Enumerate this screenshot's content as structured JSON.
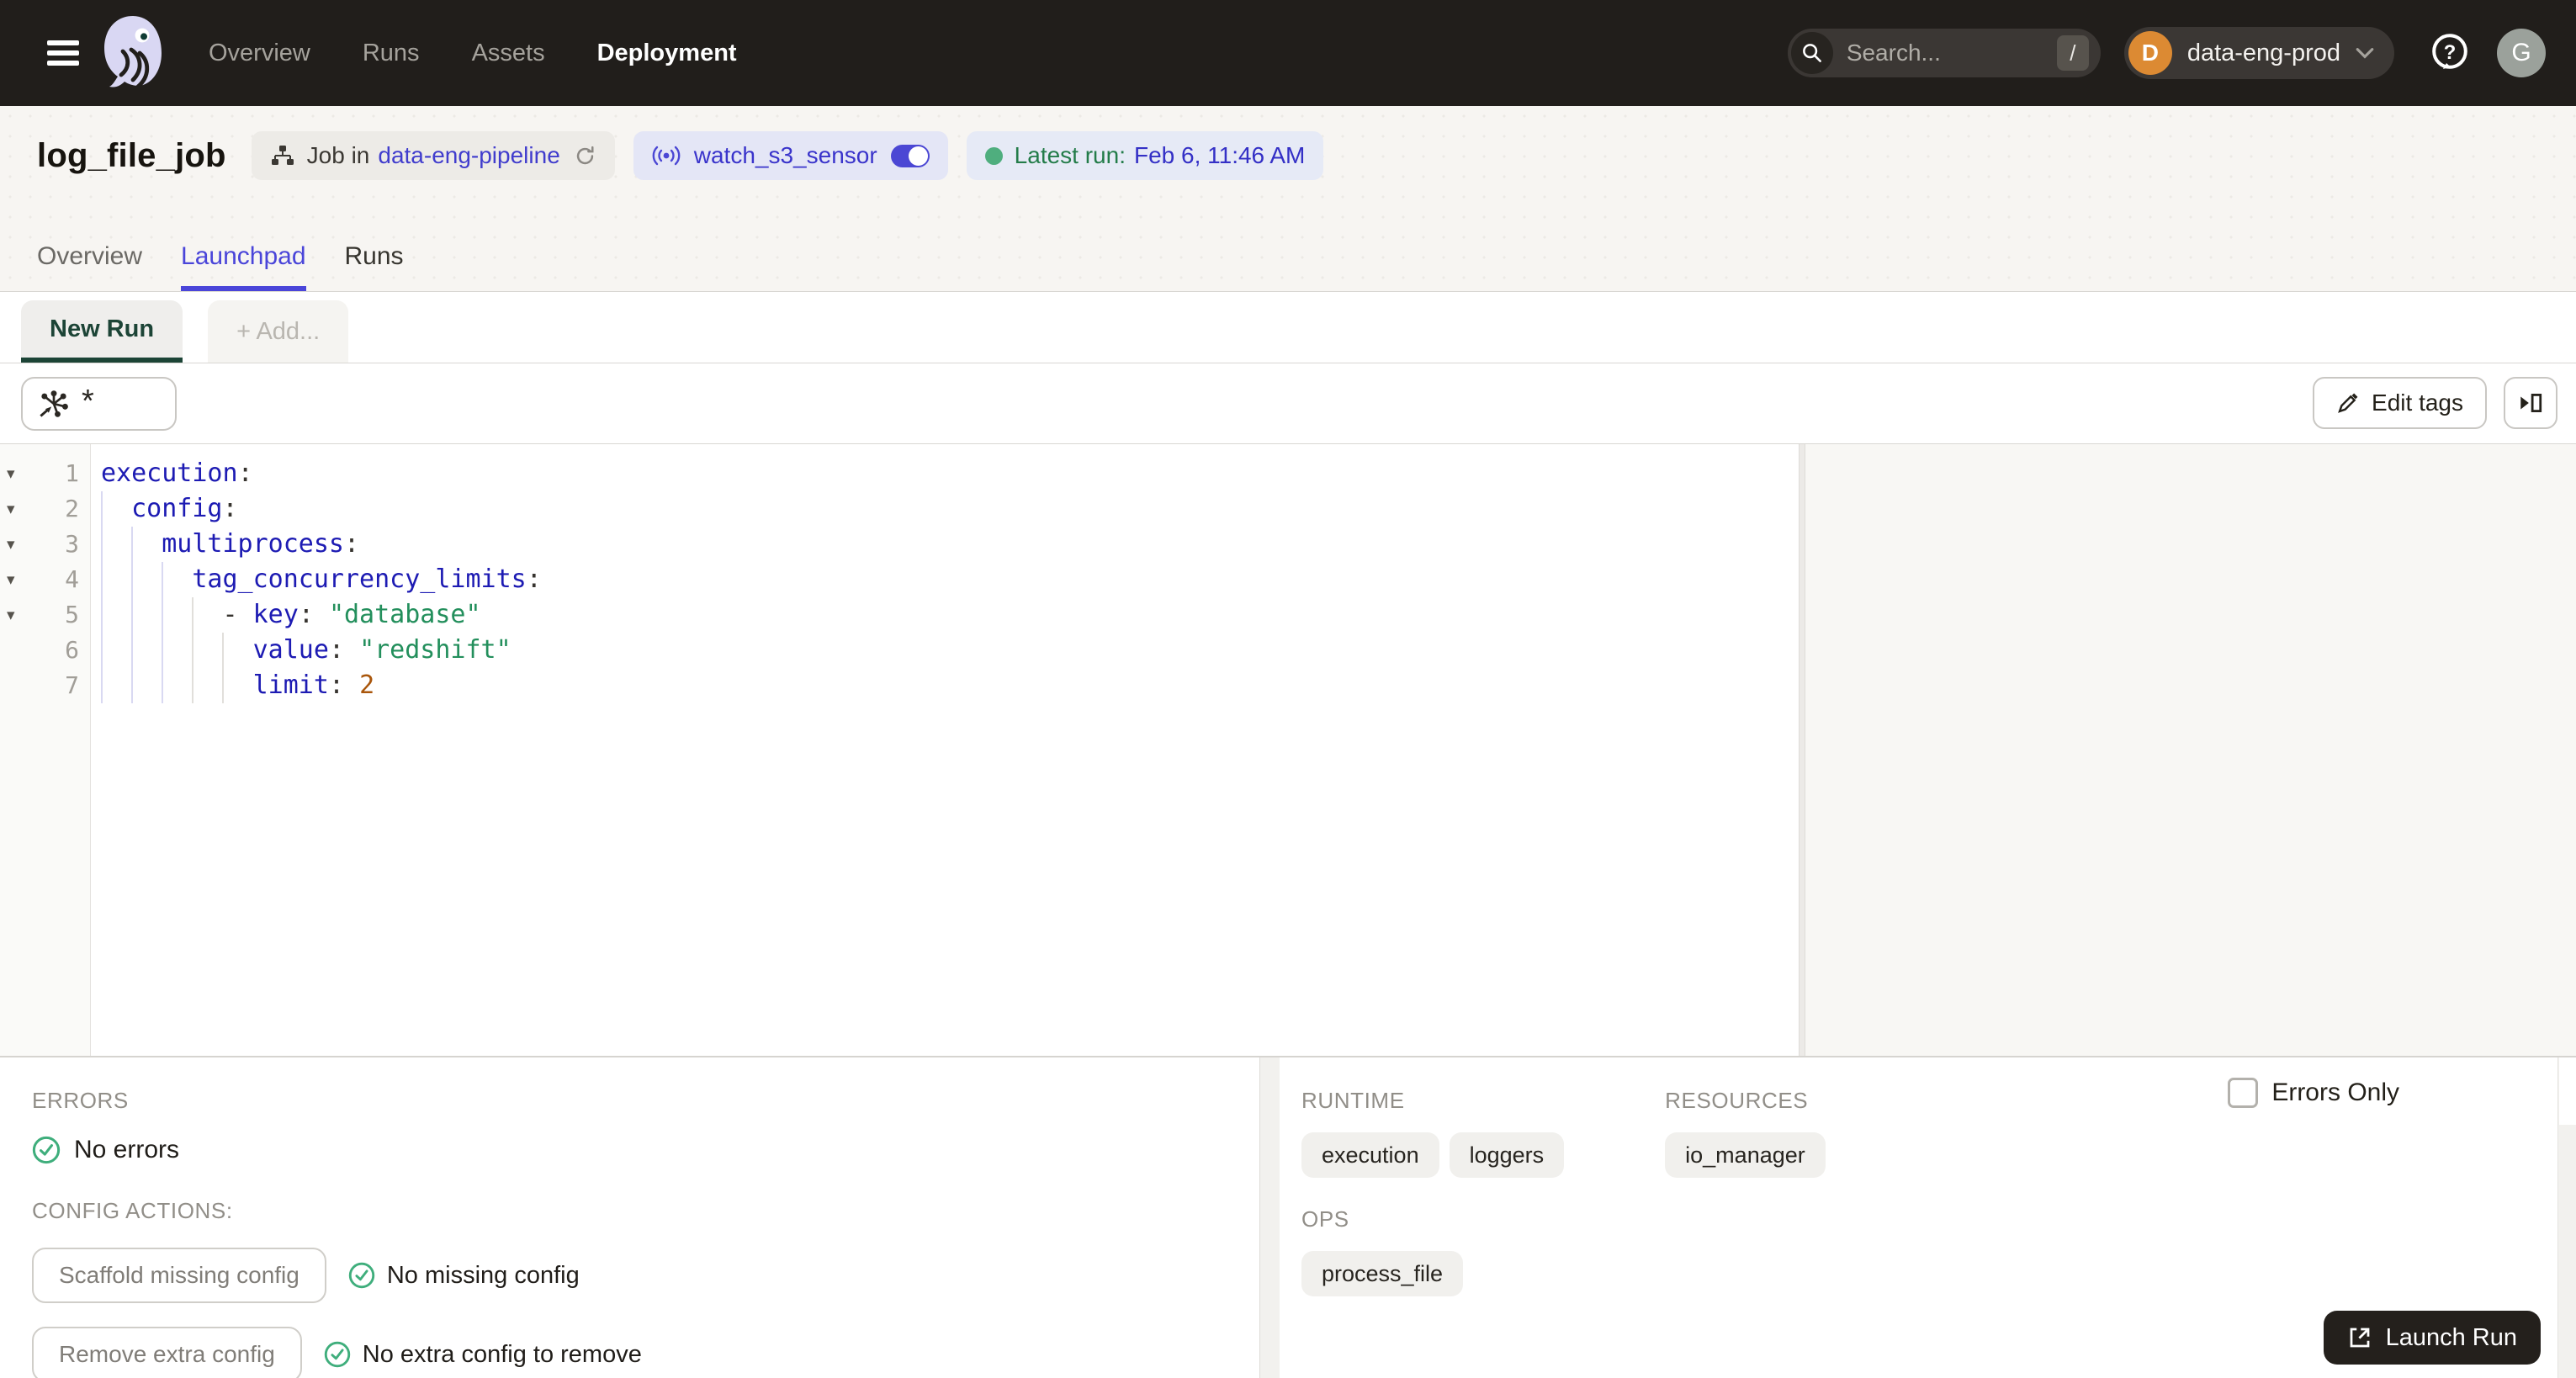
{
  "nav": {
    "links": [
      {
        "label": "Overview"
      },
      {
        "label": "Runs"
      },
      {
        "label": "Assets"
      },
      {
        "label": "Deployment"
      }
    ],
    "search": {
      "placeholder": "Search...",
      "shortcut": "/"
    },
    "deployment_switcher": {
      "initial": "D",
      "label": "data-eng-prod"
    },
    "avatar_initial": "G"
  },
  "header": {
    "title": "log_file_job",
    "job_pill": {
      "prefix": "Job in",
      "repo_link": "data-eng-pipeline"
    },
    "sensor_pill": {
      "name": "watch_s3_sensor"
    },
    "latest_run_pill": {
      "label": "Latest run:",
      "value": "Feb 6, 11:46 AM"
    },
    "tabs": [
      {
        "label": "Overview"
      },
      {
        "label": "Launchpad"
      },
      {
        "label": "Runs"
      }
    ]
  },
  "launchpad": {
    "config_tabs": {
      "active": "New Run",
      "add": "+ Add..."
    },
    "op_selector": {
      "value": "*"
    },
    "edit_tags_label": "Edit tags",
    "editor": {
      "lines": [
        {
          "n": "1",
          "indent": "",
          "tokens": [
            {
              "t": "key",
              "v": "execution"
            },
            {
              "t": "plain",
              "v": ":"
            }
          ]
        },
        {
          "n": "2",
          "indent": "  ",
          "tokens": [
            {
              "t": "key",
              "v": "config"
            },
            {
              "t": "plain",
              "v": ":"
            }
          ]
        },
        {
          "n": "3",
          "indent": "    ",
          "tokens": [
            {
              "t": "key",
              "v": "multiprocess"
            },
            {
              "t": "plain",
              "v": ":"
            }
          ]
        },
        {
          "n": "4",
          "indent": "      ",
          "tokens": [
            {
              "t": "key",
              "v": "tag_concurrency_limits"
            },
            {
              "t": "plain",
              "v": ":"
            }
          ]
        },
        {
          "n": "5",
          "indent": "        ",
          "tokens": [
            {
              "t": "plain",
              "v": "- "
            },
            {
              "t": "key",
              "v": "key"
            },
            {
              "t": "plain",
              "v": ": "
            },
            {
              "t": "str",
              "v": "\"database\""
            }
          ]
        },
        {
          "n": "6",
          "indent": "          ",
          "tokens": [
            {
              "t": "key",
              "v": "value"
            },
            {
              "t": "plain",
              "v": ": "
            },
            {
              "t": "str",
              "v": "\"redshift\""
            }
          ]
        },
        {
          "n": "7",
          "indent": "          ",
          "tokens": [
            {
              "t": "key",
              "v": "limit"
            },
            {
              "t": "plain",
              "v": ": "
            },
            {
              "t": "num",
              "v": "2"
            }
          ]
        }
      ]
    }
  },
  "bottom": {
    "errors": {
      "heading": "ERRORS",
      "status": "No errors"
    },
    "config_actions": {
      "heading": "CONFIG ACTIONS:",
      "actions": [
        {
          "button": "Scaffold missing config",
          "status": "No missing config"
        },
        {
          "button": "Remove extra config",
          "status": "No extra config to remove"
        }
      ]
    },
    "runtime": {
      "heading": "RUNTIME",
      "tags": [
        "execution",
        "loggers"
      ]
    },
    "resources": {
      "heading": "RESOURCES",
      "tags": [
        "io_manager"
      ]
    },
    "ops": {
      "heading": "OPS",
      "tags": [
        "process_file"
      ]
    },
    "errors_only_label": "Errors Only",
    "launch_button": "Launch Run"
  },
  "colors": {
    "nav_background": "#211e1b",
    "accent_indigo": "#4a45d9",
    "active_tab_green": "#1c4436",
    "status_green": "#3fae7c",
    "deployment_orange": "#dc8a33",
    "code_key": "#1d1bb3",
    "code_string": "#238f5c",
    "code_number": "#a9560b"
  }
}
